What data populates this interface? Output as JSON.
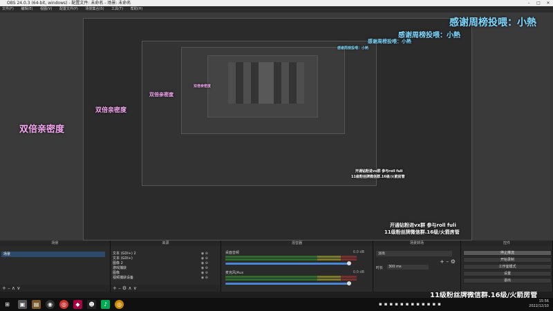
{
  "window": {
    "title": "OBS 24.0.3 (64-bit, windows) - 配置文件: 未命名 - 场景: 未命名"
  },
  "menu": [
    "文件(F)",
    "编辑(E)",
    "视图(V)",
    "配置文件(P)",
    "场景集合(S)",
    "工具(T)",
    "帮助(H)"
  ],
  "overlays": {
    "thanks": "感谢周榜投喂：小熱",
    "density": "双倍亲密度",
    "fans_line1": "开通钻粉进vx群 参与roll fuli",
    "fans_line2": "11级粉丝牌微信群.16级/火箭房管"
  },
  "docks": {
    "scenes": {
      "title": "场景",
      "items": [
        "场景"
      ]
    },
    "sources": {
      "title": "来源",
      "items": [
        "文本 (GDI+) 2",
        "文本 (GDI+)",
        "图像 2",
        "游戏捕获",
        "图像",
        "视频捕获设备"
      ]
    },
    "mixer": {
      "title": "混音器",
      "tracks": [
        {
          "name": "桌面音频",
          "db": "0.0 dB"
        },
        {
          "name": "麦克风/Aux",
          "db": "0.0 dB"
        }
      ]
    },
    "transitions": {
      "title": "场景转场",
      "type": "淡出",
      "duration_label": "时长",
      "duration": "300 ms"
    },
    "controls": {
      "title": "控件",
      "buttons": [
        "停止推流",
        "开始录制",
        "工作室模式",
        "设置",
        "退出"
      ]
    }
  },
  "taskbar": {
    "time": "15:56",
    "date": "2022/12/10"
  },
  "colors": {
    "accent": "#4a86d6",
    "pink": "#f6a8f2",
    "cyan": "#7fd8ff"
  }
}
